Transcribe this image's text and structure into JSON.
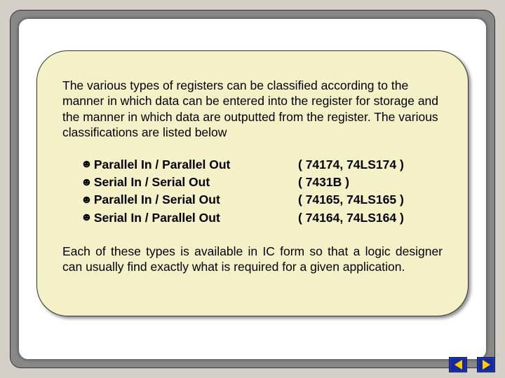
{
  "intro": "The various types of registers can be classified according to the manner in which data can be entered into the register for storage and the manner in which data are outputted from the register. The various classifications are listed below",
  "types": [
    {
      "name": "Parallel In / Parallel Out",
      "ic": "( 74174, 74LS174 )"
    },
    {
      "name": "Serial In / Serial Out",
      "ic": "( 7431B )"
    },
    {
      "name": "Parallel In / Serial Out",
      "ic": "( 74165, 74LS165 )"
    },
    {
      "name": "Serial In / Parallel Out",
      "ic": "( 74164, 74LS164 )"
    }
  ],
  "outro": "Each of these types is available in IC form so that a logic designer can usually find exactly what is required for a given application.",
  "bullet_glyph": "☻"
}
